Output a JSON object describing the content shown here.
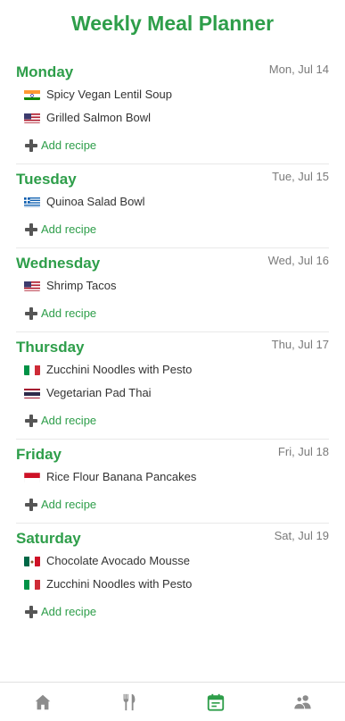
{
  "header": {
    "title": "Weekly Meal Planner"
  },
  "colors": {
    "accent": "#2e9e4a",
    "inactive_icon": "#8c8c8c"
  },
  "add_recipe_label": "Add recipe",
  "days": [
    {
      "name": "Monday",
      "date": "Mon, Jul 14",
      "recipes": [
        {
          "name": "Spicy Vegan Lentil Soup",
          "flag": "india"
        },
        {
          "name": "Grilled Salmon Bowl",
          "flag": "usa"
        }
      ]
    },
    {
      "name": "Tuesday",
      "date": "Tue, Jul 15",
      "recipes": [
        {
          "name": "Quinoa Salad Bowl",
          "flag": "greece"
        }
      ]
    },
    {
      "name": "Wednesday",
      "date": "Wed, Jul 16",
      "recipes": [
        {
          "name": "Shrimp Tacos",
          "flag": "usa"
        }
      ]
    },
    {
      "name": "Thursday",
      "date": "Thu, Jul 17",
      "recipes": [
        {
          "name": "Zucchini Noodles with Pesto",
          "flag": "italy"
        },
        {
          "name": "Vegetarian Pad Thai",
          "flag": "thailand"
        }
      ]
    },
    {
      "name": "Friday",
      "date": "Fri, Jul 18",
      "recipes": [
        {
          "name": "Rice Flour Banana Pancakes",
          "flag": "indonesia"
        }
      ]
    },
    {
      "name": "Saturday",
      "date": "Sat, Jul 19",
      "recipes": [
        {
          "name": "Chocolate Avocado Mousse",
          "flag": "mexico"
        },
        {
          "name": "Zucchini Noodles with Pesto",
          "flag": "italy"
        }
      ]
    }
  ],
  "bottom_nav": [
    {
      "icon": "home-icon",
      "active": false
    },
    {
      "icon": "fork-knife-icon",
      "active": false
    },
    {
      "icon": "calendar-icon",
      "active": true
    },
    {
      "icon": "people-icon",
      "active": false
    }
  ]
}
